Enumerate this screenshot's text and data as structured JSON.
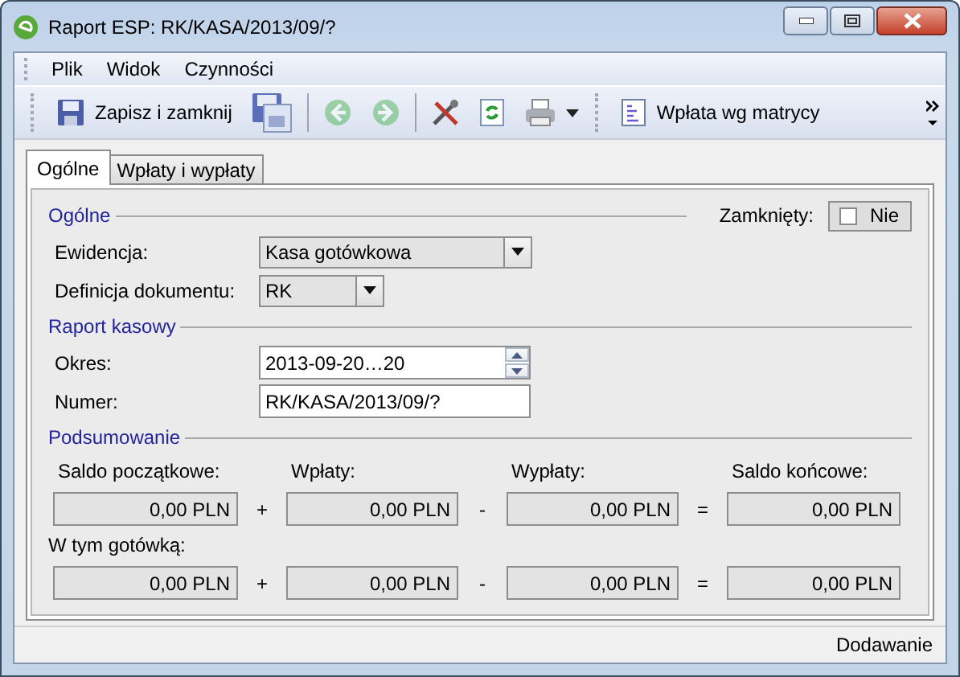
{
  "window": {
    "title": "Raport ESP: RK/KASA/2013/09/?"
  },
  "menu": [
    {
      "label": "Plik"
    },
    {
      "label": "Widok"
    },
    {
      "label": "Czynności"
    }
  ],
  "toolbar": [
    {
      "kind": "save",
      "label": "Zapisz i zamknij"
    },
    {
      "kind": "saveas"
    },
    {
      "kind": "separator"
    },
    {
      "kind": "back",
      "disabled": true
    },
    {
      "kind": "forward",
      "disabled": true
    },
    {
      "kind": "separator"
    },
    {
      "kind": "tools"
    },
    {
      "kind": "refresh"
    },
    {
      "kind": "print"
    },
    {
      "kind": "grip"
    },
    {
      "kind": "document",
      "label": "Wpłata wg matrycy"
    },
    {
      "kind": "overflow"
    }
  ],
  "tabs": [
    {
      "label": "Ogólne",
      "selected": true
    },
    {
      "label": "Wpłaty i wypłaty",
      "selected": false
    }
  ],
  "general": {
    "title": "Ogólne",
    "closed": {
      "label": "Zamknięty:",
      "checked": false,
      "text": "Nie"
    },
    "fields": [
      {
        "kind": "combo",
        "label": "Ewidencja:",
        "value": "Kasa gotówkowa"
      },
      {
        "kind": "combo",
        "label": "Definicja dokumentu:",
        "value": "RK"
      }
    ]
  },
  "report": {
    "title": "Raport kasowy",
    "fields": [
      {
        "kind": "spinner",
        "label": "Okres:",
        "value": "2013-09-20…20"
      },
      {
        "kind": "text",
        "label": "Numer:",
        "value": "RK/KASA/2013/09/?"
      }
    ]
  },
  "summary": {
    "title": "Podsumowanie",
    "headers": [
      "Saldo początkowe:",
      "Wpłaty:",
      "Wypłaty:",
      "Saldo końcowe:"
    ],
    "rows": [
      {
        "values": [
          "0,00 PLN",
          "0,00 PLN",
          "0,00 PLN",
          "0,00 PLN"
        ],
        "operators": [
          "+",
          "-",
          "="
        ]
      },
      {
        "label": "W tym gotówką:",
        "values": [
          "0,00 PLN",
          "0,00 PLN",
          "0,00 PLN",
          "0,00 PLN"
        ],
        "operators": [
          "+",
          "-",
          "="
        ]
      }
    ]
  },
  "status_bar": {
    "text": "Dodawanie"
  }
}
